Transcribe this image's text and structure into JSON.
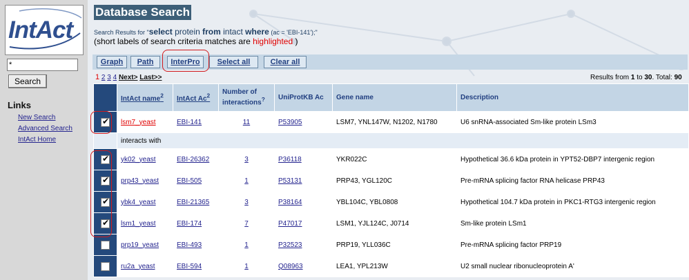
{
  "sidebar": {
    "logo_text": "IntAct",
    "search_value": "*",
    "search_button": "Search",
    "links_heading": "Links",
    "links": [
      "New Search",
      "Advanced Search",
      "IntAct Home"
    ]
  },
  "header": {
    "title": "Database Search",
    "query_prefix": "Search Results for \"",
    "query_select": "select",
    "query_mid1": " protein ",
    "query_from": "from",
    "query_mid2": " intact ",
    "query_where": "where",
    "query_cond": " (ac = 'EBI-141');\"",
    "hint_before": "(short labels of search criteria matches are ",
    "hint_highlight": "highlighted",
    "hint_after": " )"
  },
  "toolbar": {
    "buttons": [
      "Graph",
      "Path",
      "InterPro",
      "Select all",
      "Clear all"
    ]
  },
  "pagination": {
    "current": "1",
    "pages": [
      "2",
      "3",
      "4"
    ],
    "next": "Next>",
    "last": "Last>>"
  },
  "results": {
    "prefix": "Results from ",
    "from": "1",
    "to_word": " to ",
    "to": "30",
    "total_label": ".  Total: ",
    "total": "90"
  },
  "table": {
    "headers": {
      "name": "IntAct name",
      "name_sup": "2",
      "ac": "IntAct Ac",
      "ac_sup": "2",
      "num1": "Number of",
      "num2": "interactions",
      "num_sup": "?",
      "uniprot": "UniProtKB Ac",
      "gene": "Gene name",
      "desc": "Description"
    },
    "interacts_label": "interacts with",
    "query_row": {
      "name": "lsm7_yeast",
      "ac": "EBI-141",
      "num": "11",
      "uniprot": "P53905",
      "gene": "LSM7, YNL147W, N1202, N1780",
      "desc": "U6 snRNA-associated Sm-like protein LSm3"
    },
    "rows": [
      {
        "name": "yk02_yeast",
        "ac": "EBI-26362",
        "num": "3",
        "uniprot": "P36118",
        "gene": "YKR022C",
        "desc": "Hypothetical 36.6 kDa protein in YPT52-DBP7 intergenic region"
      },
      {
        "name": "prp43_yeast",
        "ac": "EBI-505",
        "num": "1",
        "uniprot": "P53131",
        "gene": "PRP43, YGL120C",
        "desc": "Pre-mRNA splicing factor RNA helicase PRP43"
      },
      {
        "name": "ybk4_yeast",
        "ac": "EBI-21365",
        "num": "3",
        "uniprot": "P38164",
        "gene": "YBL104C, YBL0808",
        "desc": "Hypothetical 104.7 kDa protein in PKC1-RTG3 intergenic region"
      },
      {
        "name": "lsm1_yeast",
        "ac": "EBI-174",
        "num": "7",
        "uniprot": "P47017",
        "gene": "LSM1, YJL124C, J0714",
        "desc": "Sm-like protein LSm1"
      },
      {
        "name": "prp19_yeast",
        "ac": "EBI-493",
        "num": "1",
        "uniprot": "P32523",
        "gene": "PRP19, YLL036C",
        "desc": "Pre-mRNA splicing factor PRP19"
      },
      {
        "name": "ru2a_yeast",
        "ac": "EBI-594",
        "num": "1",
        "uniprot": "Q08963",
        "gene": "LEA1, YPL213W",
        "desc": "U2 small nuclear ribonucleoprotein A'"
      }
    ]
  },
  "colors": {
    "title_bg": "#3d5f78",
    "checkbox_column": "#24497c",
    "header_bg": "#c3d5e5",
    "highlight": "#e00000",
    "annotation_ring": "#d2191c"
  }
}
